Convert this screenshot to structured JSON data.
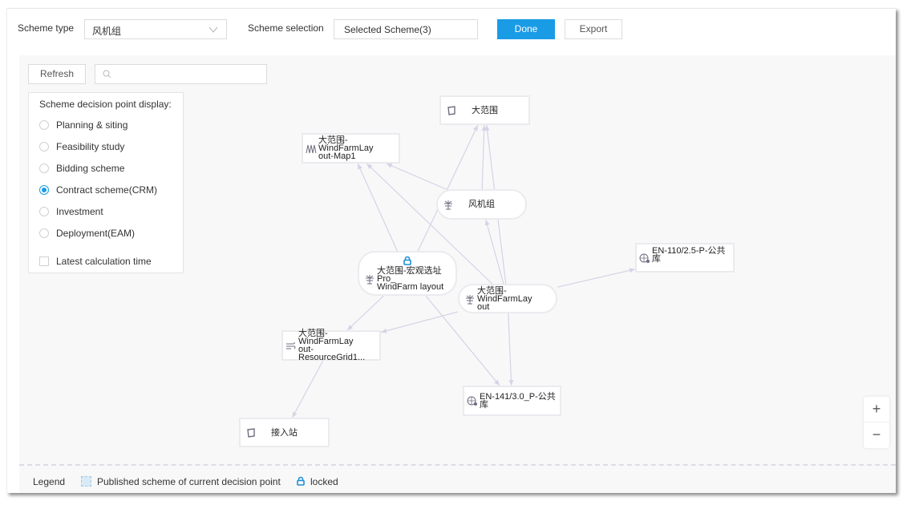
{
  "toolbar": {
    "scheme_type_label": "Scheme type",
    "scheme_type_value": "风机组",
    "scheme_selection_label": "Scheme selection",
    "scheme_selection_value": "Selected Scheme(3)",
    "done_label": "Done",
    "export_label": "Export"
  },
  "canvas_toolbar": {
    "refresh_label": "Refresh",
    "search_placeholder": ""
  },
  "decision_panel": {
    "title": "Scheme decision point display:",
    "options": [
      {
        "label": "Planning & siting",
        "selected": false
      },
      {
        "label": "Feasibility study",
        "selected": false
      },
      {
        "label": "Bidding scheme",
        "selected": false
      },
      {
        "label": "Contract scheme(CRM)",
        "selected": true
      },
      {
        "label": "Investment",
        "selected": false
      },
      {
        "label": "Deployment(EAM)",
        "selected": false
      }
    ],
    "checkbox_label": "Latest calculation time",
    "checkbox_checked": false
  },
  "graph": {
    "nodes": [
      {
        "id": "dfw",
        "label": "大范围",
        "icon": "polygon-icon",
        "shape": "rect",
        "locked": false
      },
      {
        "id": "map1",
        "label": "大范围-WindFarmLay\nout-Map1",
        "icon": "terrain-map-icon",
        "shape": "rect",
        "locked": false
      },
      {
        "id": "fjz",
        "label": "风机组",
        "icon": "wind-turbine-icon",
        "shape": "round",
        "locked": false
      },
      {
        "id": "hgxz",
        "label": "大范围-宏观选址Pro_\nWindFarm layout",
        "icon": "wind-turbine-icon",
        "shape": "round",
        "locked": true
      },
      {
        "id": "wfl",
        "label": "大范围-WindFarmLay\nout",
        "icon": "wind-turbine-icon",
        "shape": "round",
        "locked": false
      },
      {
        "id": "en110",
        "label": "EN-110/2.5-P-公共库",
        "icon": "turbine-model-icon",
        "shape": "rect",
        "locked": false
      },
      {
        "id": "grid",
        "label": "大范围-WindFarmLay\nout-ResourceGrid1...",
        "icon": "wind-resource-icon",
        "shape": "rect",
        "locked": false
      },
      {
        "id": "en141",
        "label": "EN-141/3.0_P-公共\n库",
        "icon": "turbine-model-icon",
        "shape": "rect",
        "locked": false
      },
      {
        "id": "jrz",
        "label": "接入站",
        "icon": "polygon-icon",
        "shape": "rect",
        "locked": false
      }
    ],
    "edges": [
      {
        "from": "fjz",
        "to": "dfw"
      },
      {
        "from": "fjz",
        "to": "map1"
      },
      {
        "from": "hgxz",
        "to": "dfw"
      },
      {
        "from": "hgxz",
        "to": "map1"
      },
      {
        "from": "wfl",
        "to": "dfw"
      },
      {
        "from": "wfl",
        "to": "map1"
      },
      {
        "from": "wfl",
        "to": "fjz"
      },
      {
        "from": "wfl",
        "to": "en110"
      },
      {
        "from": "wfl",
        "to": "grid"
      },
      {
        "from": "wfl",
        "to": "en141"
      },
      {
        "from": "hgxz",
        "to": "en141"
      },
      {
        "from": "hgxz",
        "to": "grid"
      },
      {
        "from": "grid",
        "to": "jrz"
      }
    ]
  },
  "zoom_controls": {
    "zoom_in": "+",
    "zoom_out": "−"
  },
  "legend": {
    "title": "Legend",
    "published_label": "Published scheme of current decision point",
    "locked_label": "locked"
  },
  "colors": {
    "primary": "#1a9be6",
    "edge": "#d4d4e6",
    "lock": "#1a8fd6",
    "published_swatch": "#d9ebf7"
  }
}
